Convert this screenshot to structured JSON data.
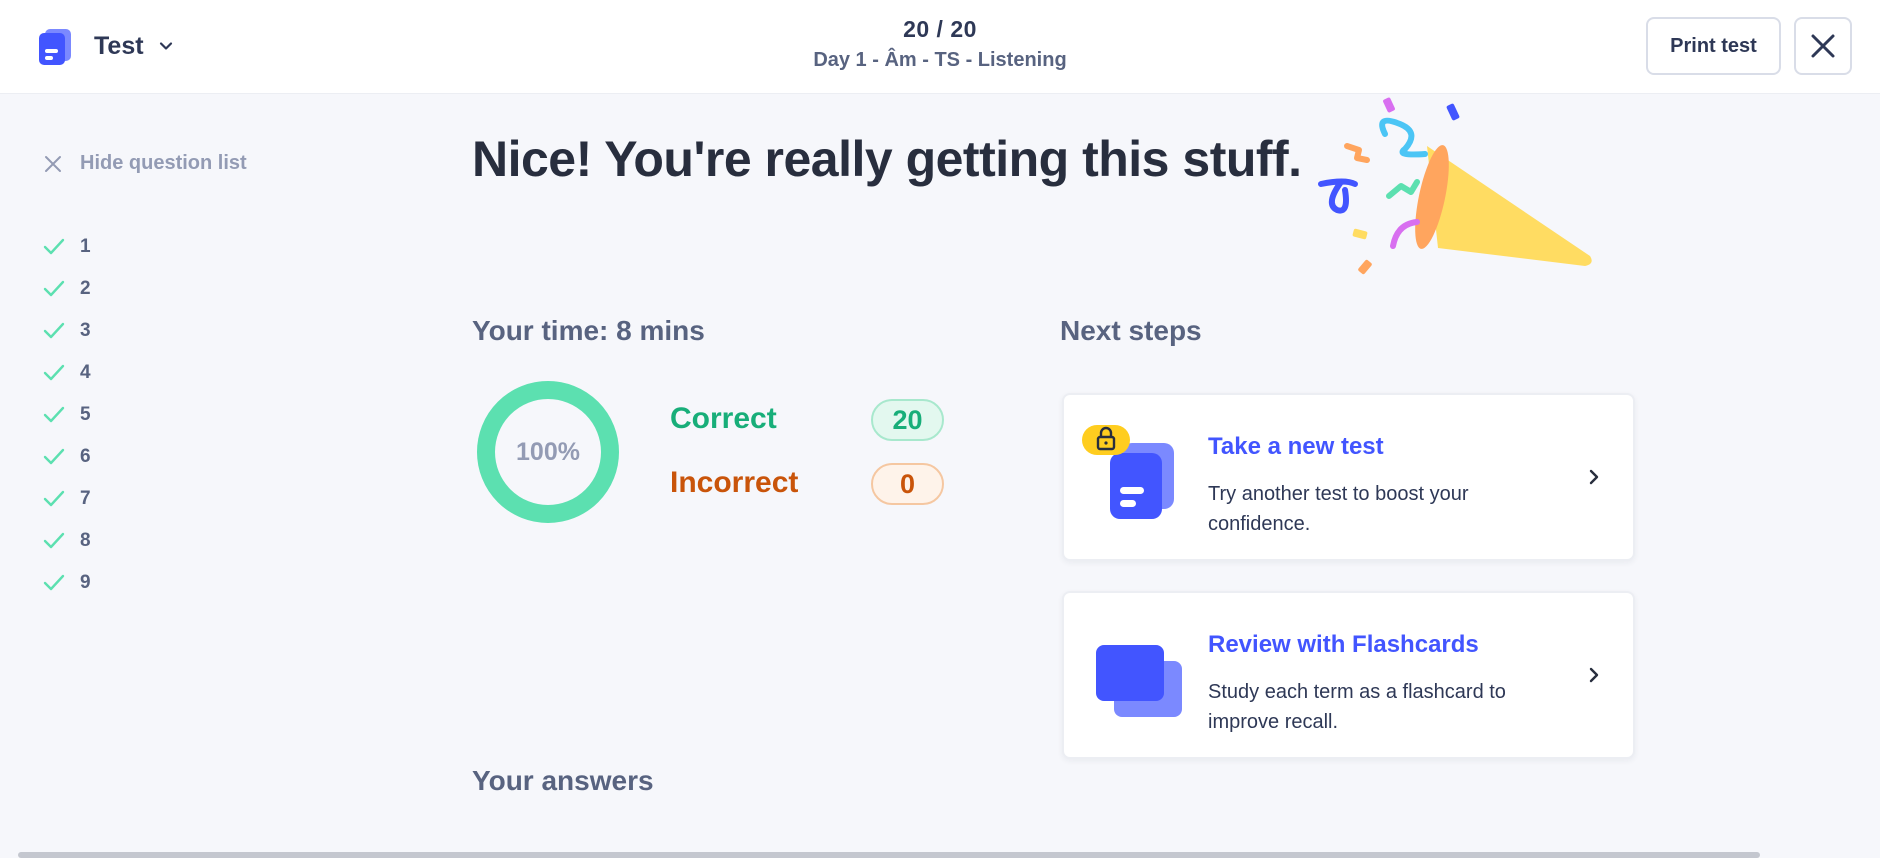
{
  "header": {
    "mode_label": "Test",
    "progress_count": "20 / 20",
    "progress_title": "Day 1 - Âm - TS - Listening",
    "print_label": "Print test"
  },
  "sidebar": {
    "hide_label": "Hide question list",
    "questions": [
      "1",
      "2",
      "3",
      "4",
      "5",
      "6",
      "7",
      "8",
      "9"
    ]
  },
  "main": {
    "headline": "Nice! You're really getting this stuff.",
    "time_heading": "Your time: 8 mins",
    "score_percent": "100%",
    "score_fraction": 1.0,
    "correct_label": "Correct",
    "correct_count": "20",
    "incorrect_label": "Incorrect",
    "incorrect_count": "0",
    "next_steps_heading": "Next steps",
    "answers_heading": "Your answers"
  },
  "next_steps": [
    {
      "title": "Take a new test",
      "description": "Try another test to boost your confidence.",
      "icon": "test-document-icon",
      "locked": true
    },
    {
      "title": "Review with Flashcards",
      "description": "Study each term as a flashcard to improve recall.",
      "icon": "flashcards-icon",
      "locked": false
    }
  ],
  "colors": {
    "brand": "#4255ff",
    "correct": "#18ae79",
    "incorrect": "#c9540a",
    "donut": "#5ce0b0"
  }
}
